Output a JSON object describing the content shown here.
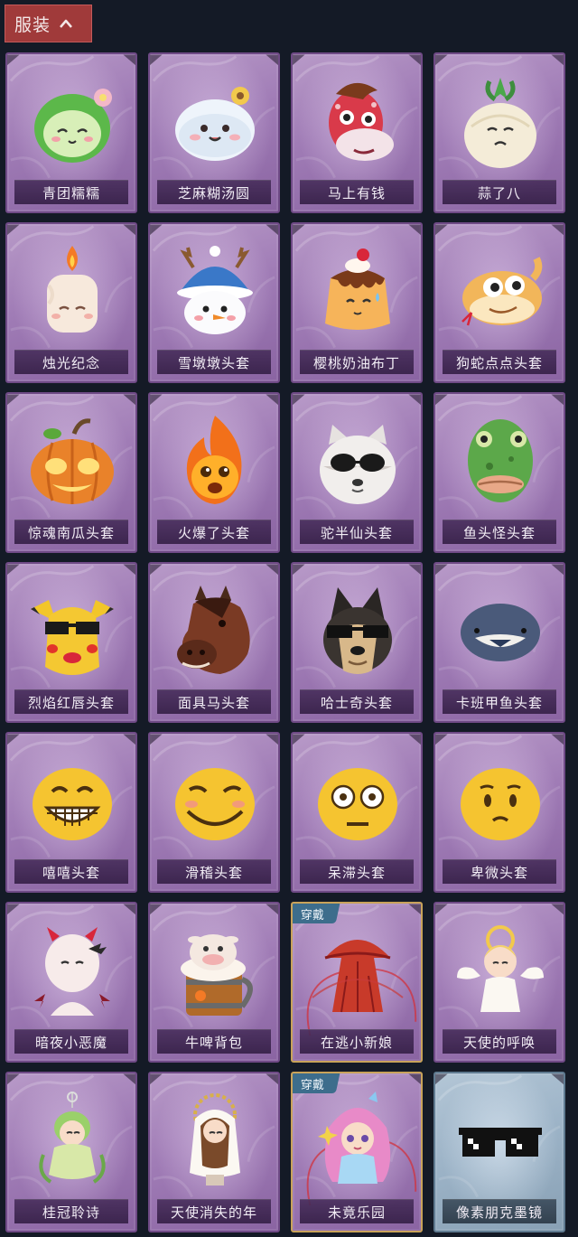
{
  "section": {
    "title": "服装",
    "toggle_icon": "chevron-up-icon"
  },
  "colors": {
    "section_tab_bg": "#a03a3a",
    "background": "#141a26",
    "card_purple": "#a07cb6",
    "card_blue": "#9bb2c6",
    "equipped_border": "#c9a35a",
    "badge_bg": "#3d6d8c"
  },
  "items": [
    {
      "name": "青团糯糯",
      "icon": "green-dumpling-head-icon",
      "style": "purple"
    },
    {
      "name": "芝麻糊汤圆",
      "icon": "white-rice-ball-head-icon",
      "style": "purple"
    },
    {
      "name": "马上有钱",
      "icon": "red-horse-head-icon",
      "style": "purple"
    },
    {
      "name": "蒜了八",
      "icon": "garlic-head-icon",
      "style": "purple"
    },
    {
      "name": "烛光纪念",
      "icon": "candle-head-icon",
      "style": "purple"
    },
    {
      "name": "雪墩墩头套",
      "icon": "snowman-head-icon",
      "style": "purple"
    },
    {
      "name": "樱桃奶油布丁",
      "icon": "pudding-head-icon",
      "style": "purple"
    },
    {
      "name": "狗蛇点点头套",
      "icon": "snake-head-icon",
      "style": "purple"
    },
    {
      "name": "惊魂南瓜头套",
      "icon": "pumpkin-head-icon",
      "style": "purple"
    },
    {
      "name": "火爆了头套",
      "icon": "fireball-head-icon",
      "style": "purple"
    },
    {
      "name": "驼半仙头套",
      "icon": "raccoon-sunglasses-head-icon",
      "style": "purple"
    },
    {
      "name": "鱼头怪头套",
      "icon": "fish-head-icon",
      "style": "purple"
    },
    {
      "name": "烈焰红唇头套",
      "icon": "yellow-mouse-sunglasses-head-icon",
      "style": "purple"
    },
    {
      "name": "面具马头套",
      "icon": "horse-mask-head-icon",
      "style": "purple"
    },
    {
      "name": "哈士奇头套",
      "icon": "husky-sunglasses-head-icon",
      "style": "purple"
    },
    {
      "name": "卡班甲鱼头套",
      "icon": "round-fish-head-icon",
      "style": "purple"
    },
    {
      "name": "嘻嘻头套",
      "icon": "grin-emoji-head-icon",
      "style": "purple"
    },
    {
      "name": "滑稽头套",
      "icon": "smirk-emoji-head-icon",
      "style": "purple"
    },
    {
      "name": "呆滞头套",
      "icon": "stare-emoji-head-icon",
      "style": "purple"
    },
    {
      "name": "卑微头套",
      "icon": "shy-emoji-head-icon",
      "style": "purple"
    },
    {
      "name": "暗夜小恶魔",
      "icon": "little-devil-icon",
      "style": "purple"
    },
    {
      "name": "牛啤背包",
      "icon": "cow-beer-mug-backpack-icon",
      "style": "purple"
    },
    {
      "name": "在逃小新娘",
      "icon": "red-umbrella-bride-icon",
      "style": "purple",
      "badge": "穿戴"
    },
    {
      "name": "天使的呼唤",
      "icon": "angel-figure-icon",
      "style": "purple"
    },
    {
      "name": "桂冠聆诗",
      "icon": "laurel-fairy-charm-icon",
      "style": "purple"
    },
    {
      "name": "天使消失的年",
      "icon": "halo-girl-figure-icon",
      "style": "purple"
    },
    {
      "name": "未竟乐园",
      "icon": "pink-hair-doll-icon",
      "style": "purple",
      "badge": "穿戴"
    },
    {
      "name": "像素朋克墨镜",
      "icon": "pixel-sunglasses-icon",
      "style": "blue"
    }
  ]
}
